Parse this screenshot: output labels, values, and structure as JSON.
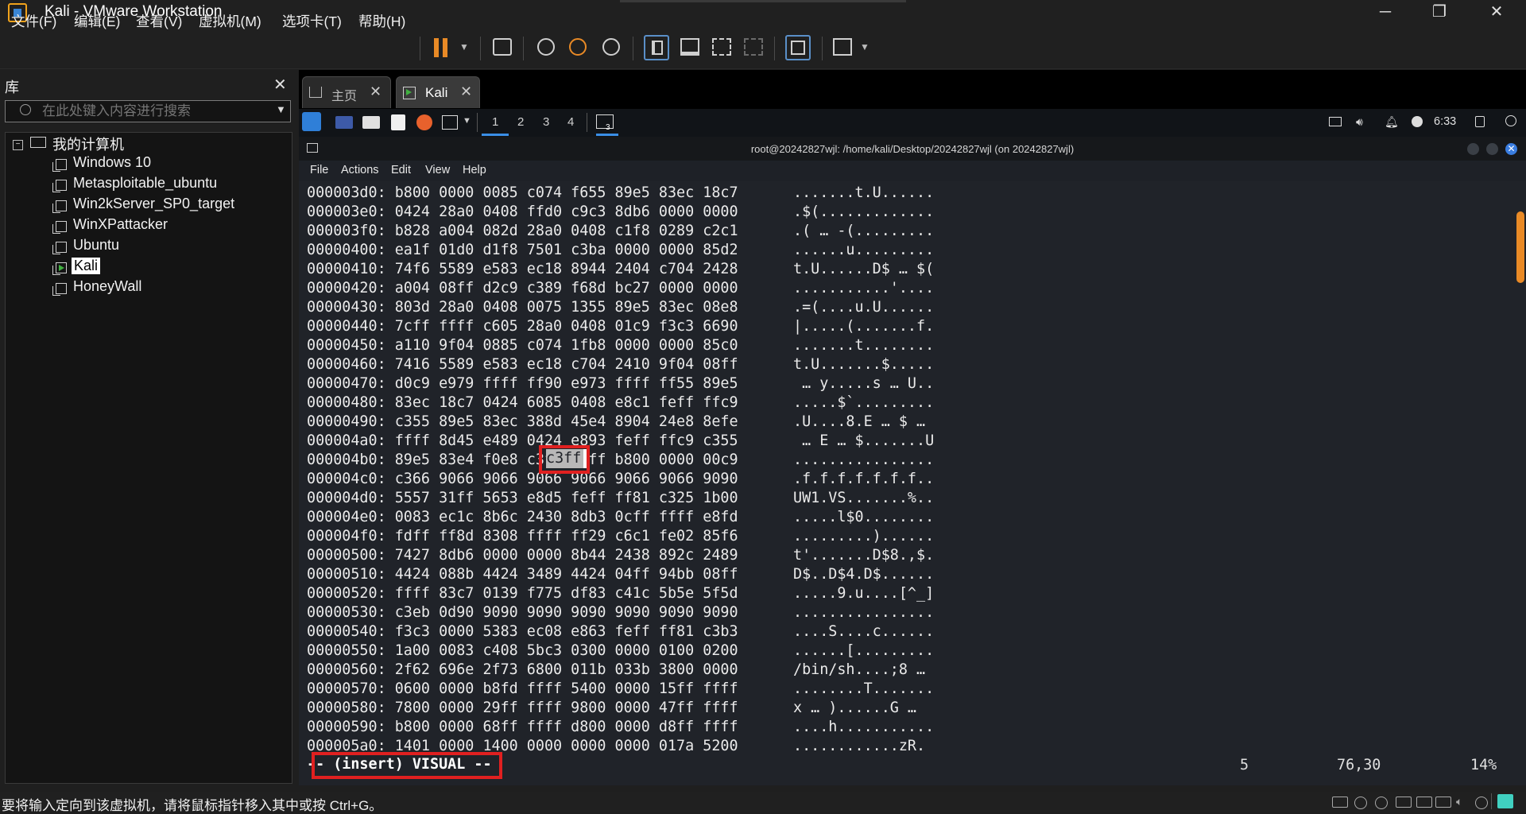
{
  "window": {
    "title": "Kali - VMware Workstation",
    "min_glyph": "─",
    "max_glyph": "❐",
    "close_glyph": "✕"
  },
  "menu": [
    "文件(F)",
    "编辑(E)",
    "查看(V)",
    "虚拟机(M)",
    "选项卡(T)",
    "帮助(H)"
  ],
  "library": {
    "title": "库",
    "search_placeholder": "在此处键入内容进行搜索",
    "root": "我的计算机",
    "vms": [
      "Windows 10",
      "Metasploitable_ubuntu",
      "Win2kServer_SP0_target",
      "WinXPattacker",
      "Ubuntu",
      "Kali",
      "HoneyWall"
    ],
    "selected": "Kali"
  },
  "tabs": [
    {
      "label": "主页",
      "active": false
    },
    {
      "label": "Kali",
      "active": true
    }
  ],
  "kali_panel": {
    "workspaces": [
      "1",
      "2",
      "3",
      "4"
    ],
    "active_workspace": "1",
    "terminal_badge": "3",
    "clock": "6:33"
  },
  "terminal": {
    "title": "root@20242827wjl: /home/kali/Desktop/20242827wjl (on 20242827wjl)",
    "menu": [
      "File",
      "Actions",
      "Edit",
      "View",
      "Help"
    ],
    "lines": [
      {
        "hex": "000003d0: b800 0000 0085 c074 f655 89e5 83ec 18c7",
        "ascii": ".......t.U......"
      },
      {
        "hex": "000003e0: 0424 28a0 0408 ffd0 c9c3 8db6 0000 0000",
        "ascii": ".$(............."
      },
      {
        "hex": "000003f0: b828 a004 082d 28a0 0408 c1f8 0289 c2c1",
        "ascii": ".( … -(........."
      },
      {
        "hex": "00000400: ea1f 01d0 d1f8 7501 c3ba 0000 0000 85d2",
        "ascii": "......u........."
      },
      {
        "hex": "00000410: 74f6 5589 e583 ec18 8944 2404 c704 2428",
        "ascii": "t.U......D$ … $("
      },
      {
        "hex": "00000420: a004 08ff d2c9 c389 f68d bc27 0000 0000",
        "ascii": "...........'...."
      },
      {
        "hex": "00000430: 803d 28a0 0408 0075 1355 89e5 83ec 08e8",
        "ascii": ".=(....u.U......"
      },
      {
        "hex": "00000440: 7cff ffff c605 28a0 0408 01c9 f3c3 6690",
        "ascii": "|.....(.......f."
      },
      {
        "hex": "00000450: a110 9f04 0885 c074 1fb8 0000 0000 85c0",
        "ascii": ".......t........"
      },
      {
        "hex": "00000460: 7416 5589 e583 ec18 c704 2410 9f04 08ff",
        "ascii": "t.U.......$....."
      },
      {
        "hex": "00000470: d0c9 e979 ffff ff90 e973 ffff ff55 89e5",
        "ascii": " … y.....s … U.."
      },
      {
        "hex": "00000480: 83ec 18c7 0424 6085 0408 e8c1 feff ffc9",
        "ascii": ".....$`........."
      },
      {
        "hex": "00000490: c355 89e5 83ec 388d 45e4 8904 24e8 8efe",
        "ascii": ".U....8.E … $ …"
      },
      {
        "hex": "000004a0: ffff 8d45 e489 0424 e893 feff ffc9 c355",
        "ascii": " … E … $.......U"
      },
      {
        "hex": "000004b0: 89e5 83e4 f0e8 c3ff ffff b800 0000 00c9",
        "ascii": "................"
      },
      {
        "hex": "000004c0: c366 9066 9066 9066 9066 9066 9066 9090",
        "ascii": ".f.f.f.f.f.f.f.."
      },
      {
        "hex": "000004d0: 5557 31ff 5653 e8d5 feff ff81 c325 1b00",
        "ascii": "UW1.VS.......%.."
      },
      {
        "hex": "000004e0: 0083 ec1c 8b6c 2430 8db3 0cff ffff e8fd",
        "ascii": ".....l$0........"
      },
      {
        "hex": "000004f0: fdff ff8d 8308 ffff ff29 c6c1 fe02 85f6",
        "ascii": ".........)......"
      },
      {
        "hex": "00000500: 7427 8db6 0000 0000 8b44 2438 892c 2489",
        "ascii": "t'.......D$8.,$."
      },
      {
        "hex": "00000510: 4424 088b 4424 3489 4424 04ff 94bb 08ff",
        "ascii": "D$..D$4.D$......"
      },
      {
        "hex": "00000520: ffff 83c7 0139 f775 df83 c41c 5b5e 5f5d",
        "ascii": ".....9.u....[^_]"
      },
      {
        "hex": "00000530: c3eb 0d90 9090 9090 9090 9090 9090 9090",
        "ascii": "................"
      },
      {
        "hex": "00000540: f3c3 0000 5383 ec08 e863 feff ff81 c3b3",
        "ascii": "....S....c......"
      },
      {
        "hex": "00000550: 1a00 0083 c408 5bc3 0300 0000 0100 0200",
        "ascii": "......[........."
      },
      {
        "hex": "00000560: 2f62 696e 2f73 6800 011b 033b 3800 0000",
        "ascii": "/bin/sh....;8 …"
      },
      {
        "hex": "00000570: 0600 0000 b8fd ffff 5400 0000 15ff ffff",
        "ascii": "........T......."
      },
      {
        "hex": "00000580: 7800 0000 29ff ffff 9800 0000 47ff ffff",
        "ascii": "x … )......G …"
      },
      {
        "hex": "00000590: b800 0000 68ff ffff d800 0000 d8ff ffff",
        "ascii": "....h..........."
      },
      {
        "hex": "000005a0: 1401 0000 1400 0000 0000 0000 017a 5200",
        "ascii": "............zR."
      }
    ],
    "selection": "c3ff",
    "mode": "-- (insert) VISUAL --",
    "status_count": "5",
    "status_pos": "76,30",
    "status_percent": "14%"
  },
  "statusbar": {
    "text": "要将输入定向到该虚拟机，请将鼠标指针移入其中或按 Ctrl+G。"
  },
  "colors": {
    "accent_orange": "#e98a26",
    "highlight_red": "#e02020",
    "vm_green": "#40b040"
  }
}
